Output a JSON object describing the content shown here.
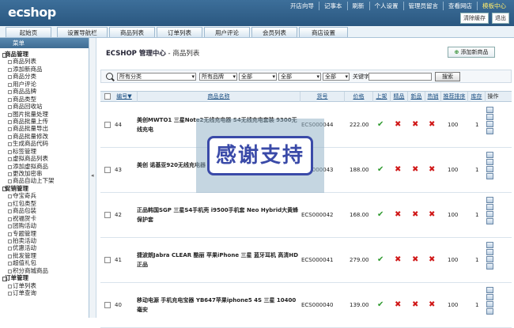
{
  "logo": "ecshop",
  "top_links": [
    "开店向导",
    "记事本",
    "刷新",
    "个人设置",
    "管理员留言",
    "查看网店",
    "模板中心"
  ],
  "top_buttons": [
    "清除缓存",
    "退出"
  ],
  "nav_tabs": [
    "起始页",
    "设置导航栏",
    "商品列表",
    "订单列表",
    "用户评论",
    "会员列表",
    "商店设置"
  ],
  "menu": {
    "title": "菜单",
    "items": [
      {
        "label": "商品管理",
        "group": true
      },
      {
        "label": "商品列表"
      },
      {
        "label": "添加新商品"
      },
      {
        "label": "商品分类"
      },
      {
        "label": "用户评论"
      },
      {
        "label": "商品品牌"
      },
      {
        "label": "商品类型"
      },
      {
        "label": "商品回收站"
      },
      {
        "label": "图片批量处理"
      },
      {
        "label": "商品批量上传"
      },
      {
        "label": "商品批量导出"
      },
      {
        "label": "商品批量修改"
      },
      {
        "label": "生成商品代码"
      },
      {
        "label": "标签管理"
      },
      {
        "label": "虚拟商品列表"
      },
      {
        "label": "添加虚拟商品"
      },
      {
        "label": "更改加密串"
      },
      {
        "label": "商品自动上下架"
      },
      {
        "label": "促销管理",
        "group": true
      },
      {
        "label": "夺宝奇兵"
      },
      {
        "label": "红包类型"
      },
      {
        "label": "商品包装"
      },
      {
        "label": "祝福贺卡"
      },
      {
        "label": "团购活动"
      },
      {
        "label": "专题管理"
      },
      {
        "label": "拍卖活动"
      },
      {
        "label": "优惠活动"
      },
      {
        "label": "批发管理"
      },
      {
        "label": "超值礼包"
      },
      {
        "label": "积分商城商品"
      },
      {
        "label": "订单管理",
        "group": true
      },
      {
        "label": "订单列表"
      },
      {
        "label": "订单查询"
      }
    ]
  },
  "page": {
    "title": "ECSHOP 管理中心",
    "subtitle": " - 商品列表",
    "add_button": "添加新商品"
  },
  "filter": {
    "category": "所有分类",
    "brand": "所有品牌",
    "sel3": "全部",
    "sel4": "全部",
    "sel5": "全部",
    "keyword_label": "关键字",
    "search_button": "搜索"
  },
  "table": {
    "headers": {
      "id": "编号▼",
      "name": "商品名称",
      "sn": "货号",
      "price": "价格",
      "on_sale": "上架",
      "best": "精品",
      "new": "新品",
      "hot": "热销",
      "sort": "推荐排序",
      "stock": "库存",
      "ops": "操作"
    },
    "rows": [
      {
        "id": "44",
        "name": "美创MWTO1 三星Note2无线充电器 S4无线充电套装 9300无线充电",
        "sn": "ECS000044",
        "price": "222.00",
        "sort": "100",
        "stock": "1"
      },
      {
        "id": "43",
        "name": "美创 诺基亚920无线充电器 lumia920无线充电",
        "sn": "ECS000043",
        "price": "188.00",
        "sort": "100",
        "stock": "1"
      },
      {
        "id": "42",
        "name": "正品韩国SGP 三星S4手机壳 i9500手机套 Neo Hybrid大黄蜂保护套",
        "sn": "ECS000042",
        "price": "168.00",
        "sort": "100",
        "stock": "1"
      },
      {
        "id": "41",
        "name": "捷波朗Jabra CLEAR 酷丽 苹果iPhone 三星 蓝牙耳机 高清HD 正品",
        "sn": "ECS000041",
        "price": "279.00",
        "sort": "100",
        "stock": "1"
      },
      {
        "id": "40",
        "name": "移动电源 手机充电宝器 YB647苹果iphone5 4S 三星 10400毫安",
        "sn": "ECS000040",
        "price": "139.00",
        "sort": "100",
        "stock": "1"
      }
    ]
  },
  "overlay_text": "感谢支持",
  "colors": {
    "topbar": "#2f5f8a",
    "check": "#2e9a2e",
    "cross": "#d01818",
    "overlay_border": "#3a4aa8"
  }
}
